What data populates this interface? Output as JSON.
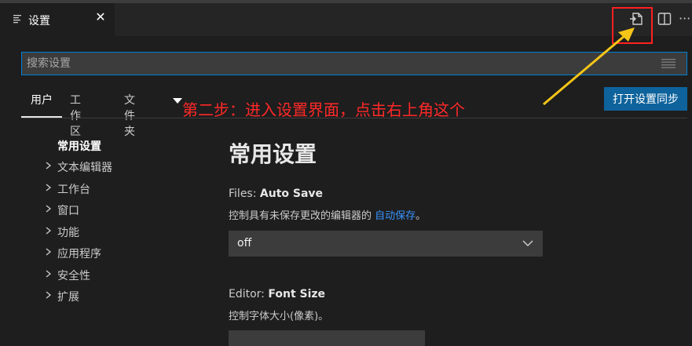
{
  "tab": {
    "title": "设置",
    "close": "✕"
  },
  "actions": {
    "more": "···"
  },
  "search": {
    "placeholder": "搜索设置"
  },
  "scopes": [
    {
      "label": "用户"
    },
    {
      "label": "工作区"
    },
    {
      "label": "文件夹"
    }
  ],
  "sync_button": "打开设置同步",
  "annotation": "第二步：进入设置界面，点击右上角这个",
  "toc": [
    {
      "label": "常用设置"
    },
    {
      "label": "文本编辑器"
    },
    {
      "label": "工作台"
    },
    {
      "label": "窗口"
    },
    {
      "label": "功能"
    },
    {
      "label": "应用程序"
    },
    {
      "label": "安全性"
    },
    {
      "label": "扩展"
    }
  ],
  "main": {
    "section_title": "常用设置",
    "auto_save": {
      "category": "Files: ",
      "name": "Auto Save",
      "description": "控制具有未保存更改的编辑器的 ",
      "link": "自动保存",
      "description_end": "。",
      "value": "off"
    },
    "font_size": {
      "category": "Editor: ",
      "name": "Font Size",
      "description": "控制字体大小(像素)。"
    }
  },
  "colors": {
    "accent": "#007fd4",
    "button": "#0e639c",
    "annotation": "#ff2828",
    "link": "#3794ff"
  }
}
